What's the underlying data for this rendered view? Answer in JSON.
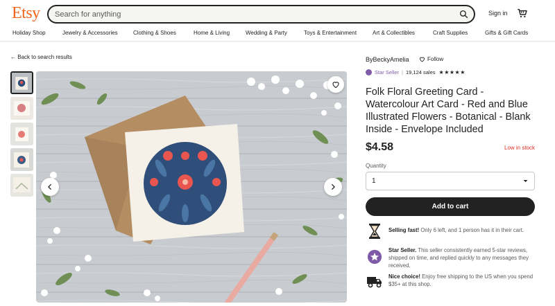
{
  "header": {
    "logo": "Etsy",
    "search_placeholder": "Search for anything",
    "signin": "Sign in"
  },
  "categories": [
    {
      "label": "Holiday Shop"
    },
    {
      "label": "Jewelry & Accessories"
    },
    {
      "label": "Clothing & Shoes"
    },
    {
      "label": "Home & Living"
    },
    {
      "label": "Wedding & Party"
    },
    {
      "label": "Toys & Entertainment"
    },
    {
      "label": "Art & Collectibles"
    },
    {
      "label": "Craft Supplies"
    },
    {
      "label": "Gifts & Gift Cards"
    }
  ],
  "back_link": "Back to search results",
  "listing": {
    "shop_name": "ByBeckyAmelia",
    "follow_label": "Follow",
    "star_seller": "Star Seller",
    "sales": "19,124 sales",
    "rating_stars": "★★★★★",
    "rating": 5,
    "title": "Folk Floral Greeting Card - Watercolour Art Card - Red and Blue Illustrated Flowers - Botanical - Blank Inside - Envelope Included",
    "price": "$4.58",
    "stock": "Low in stock",
    "quantity_label": "Quantity",
    "quantity_value": "1",
    "add_to_cart": "Add to cart"
  },
  "highlights": {
    "selling_fast_title": "Selling fast!",
    "selling_fast_text": " Only 6 left, and 1 person has it in their cart.",
    "star_seller_title": "Star Seller.",
    "star_seller_text": " This seller consistently earned 5-star reviews, shipped on time, and replied quickly to any messages they received.",
    "nice_choice_title": "Nice choice!",
    "nice_choice_text": " Enjoy free shipping to the US when you spend $35+ at this shop."
  },
  "thumbnail_count": 5,
  "colors": {
    "brand": "#f1641e",
    "star_seller": "#7f5aa8",
    "low_stock": "#d93025",
    "cart_button": "#222222"
  },
  "icons": [
    "search-icon",
    "cart-icon",
    "heart-icon",
    "chevron-left-icon",
    "chevron-right-icon",
    "hourglass-icon",
    "star-seller-icon",
    "truck-icon",
    "chevron-down-icon"
  ]
}
